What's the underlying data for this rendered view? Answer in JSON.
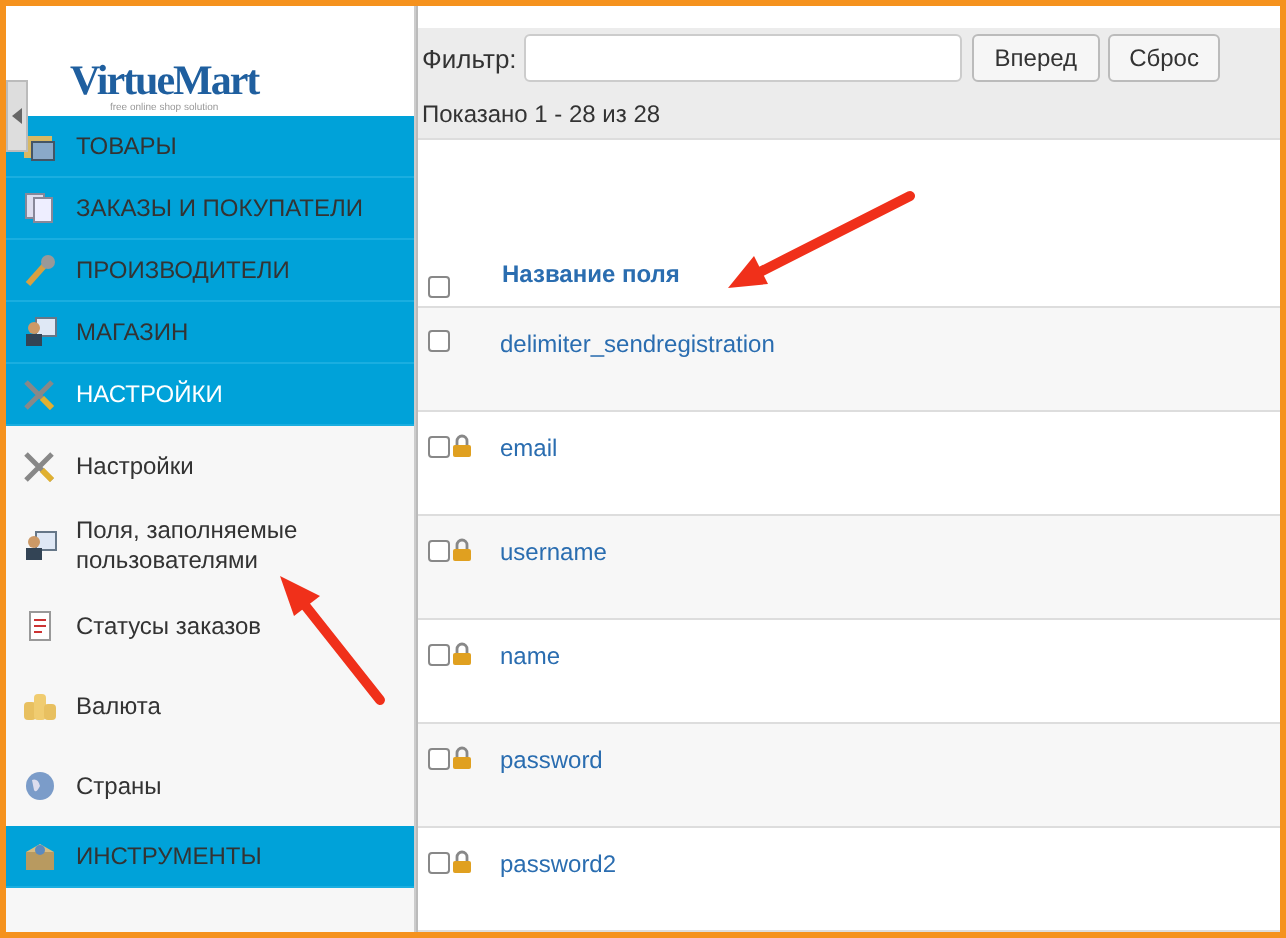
{
  "sidebar": {
    "logo": {
      "name": "VirtueMart",
      "tagline": "free online shop solution"
    },
    "menu": [
      {
        "kind": "section",
        "label": "ТОВАРЫ",
        "selected": false
      },
      {
        "kind": "section",
        "label": "ЗАКАЗЫ И ПОКУПАТЕЛИ",
        "selected": false
      },
      {
        "kind": "section",
        "label": "ПРОИЗВОДИТЕЛИ",
        "selected": false
      },
      {
        "kind": "section",
        "label": "МАГАЗИН",
        "selected": false
      },
      {
        "kind": "section",
        "label": "НАСТРОЙКИ",
        "selected": true
      },
      {
        "kind": "item",
        "label": "Настройки",
        "selected": false
      },
      {
        "kind": "item",
        "label": "Поля, заполняемые пользователями",
        "selected": false
      },
      {
        "kind": "item",
        "label": "Статусы заказов",
        "selected": false
      },
      {
        "kind": "item",
        "label": "Валюта",
        "selected": false
      },
      {
        "kind": "item",
        "label": "Страны",
        "selected": false
      },
      {
        "kind": "section",
        "label": "ИНСТРУМЕНТЫ",
        "selected": false
      }
    ]
  },
  "filter": {
    "label": "Фильтр:",
    "buttons": [
      "Вперед",
      "Сброс"
    ]
  },
  "summary": "Показано 1 - 28 из 28",
  "table": {
    "columns": [
      "Название поля"
    ],
    "header_checked": false,
    "rows": [
      {
        "name": "delimiter_sendregistration",
        "checked": false,
        "locked": false
      },
      {
        "name": "email",
        "checked": false,
        "locked": true
      },
      {
        "name": "username",
        "checked": false,
        "locked": true
      },
      {
        "name": "name",
        "checked": false,
        "locked": true
      },
      {
        "name": "password",
        "checked": false,
        "locked": true
      },
      {
        "name": "password2",
        "checked": false,
        "locked": true
      }
    ]
  }
}
